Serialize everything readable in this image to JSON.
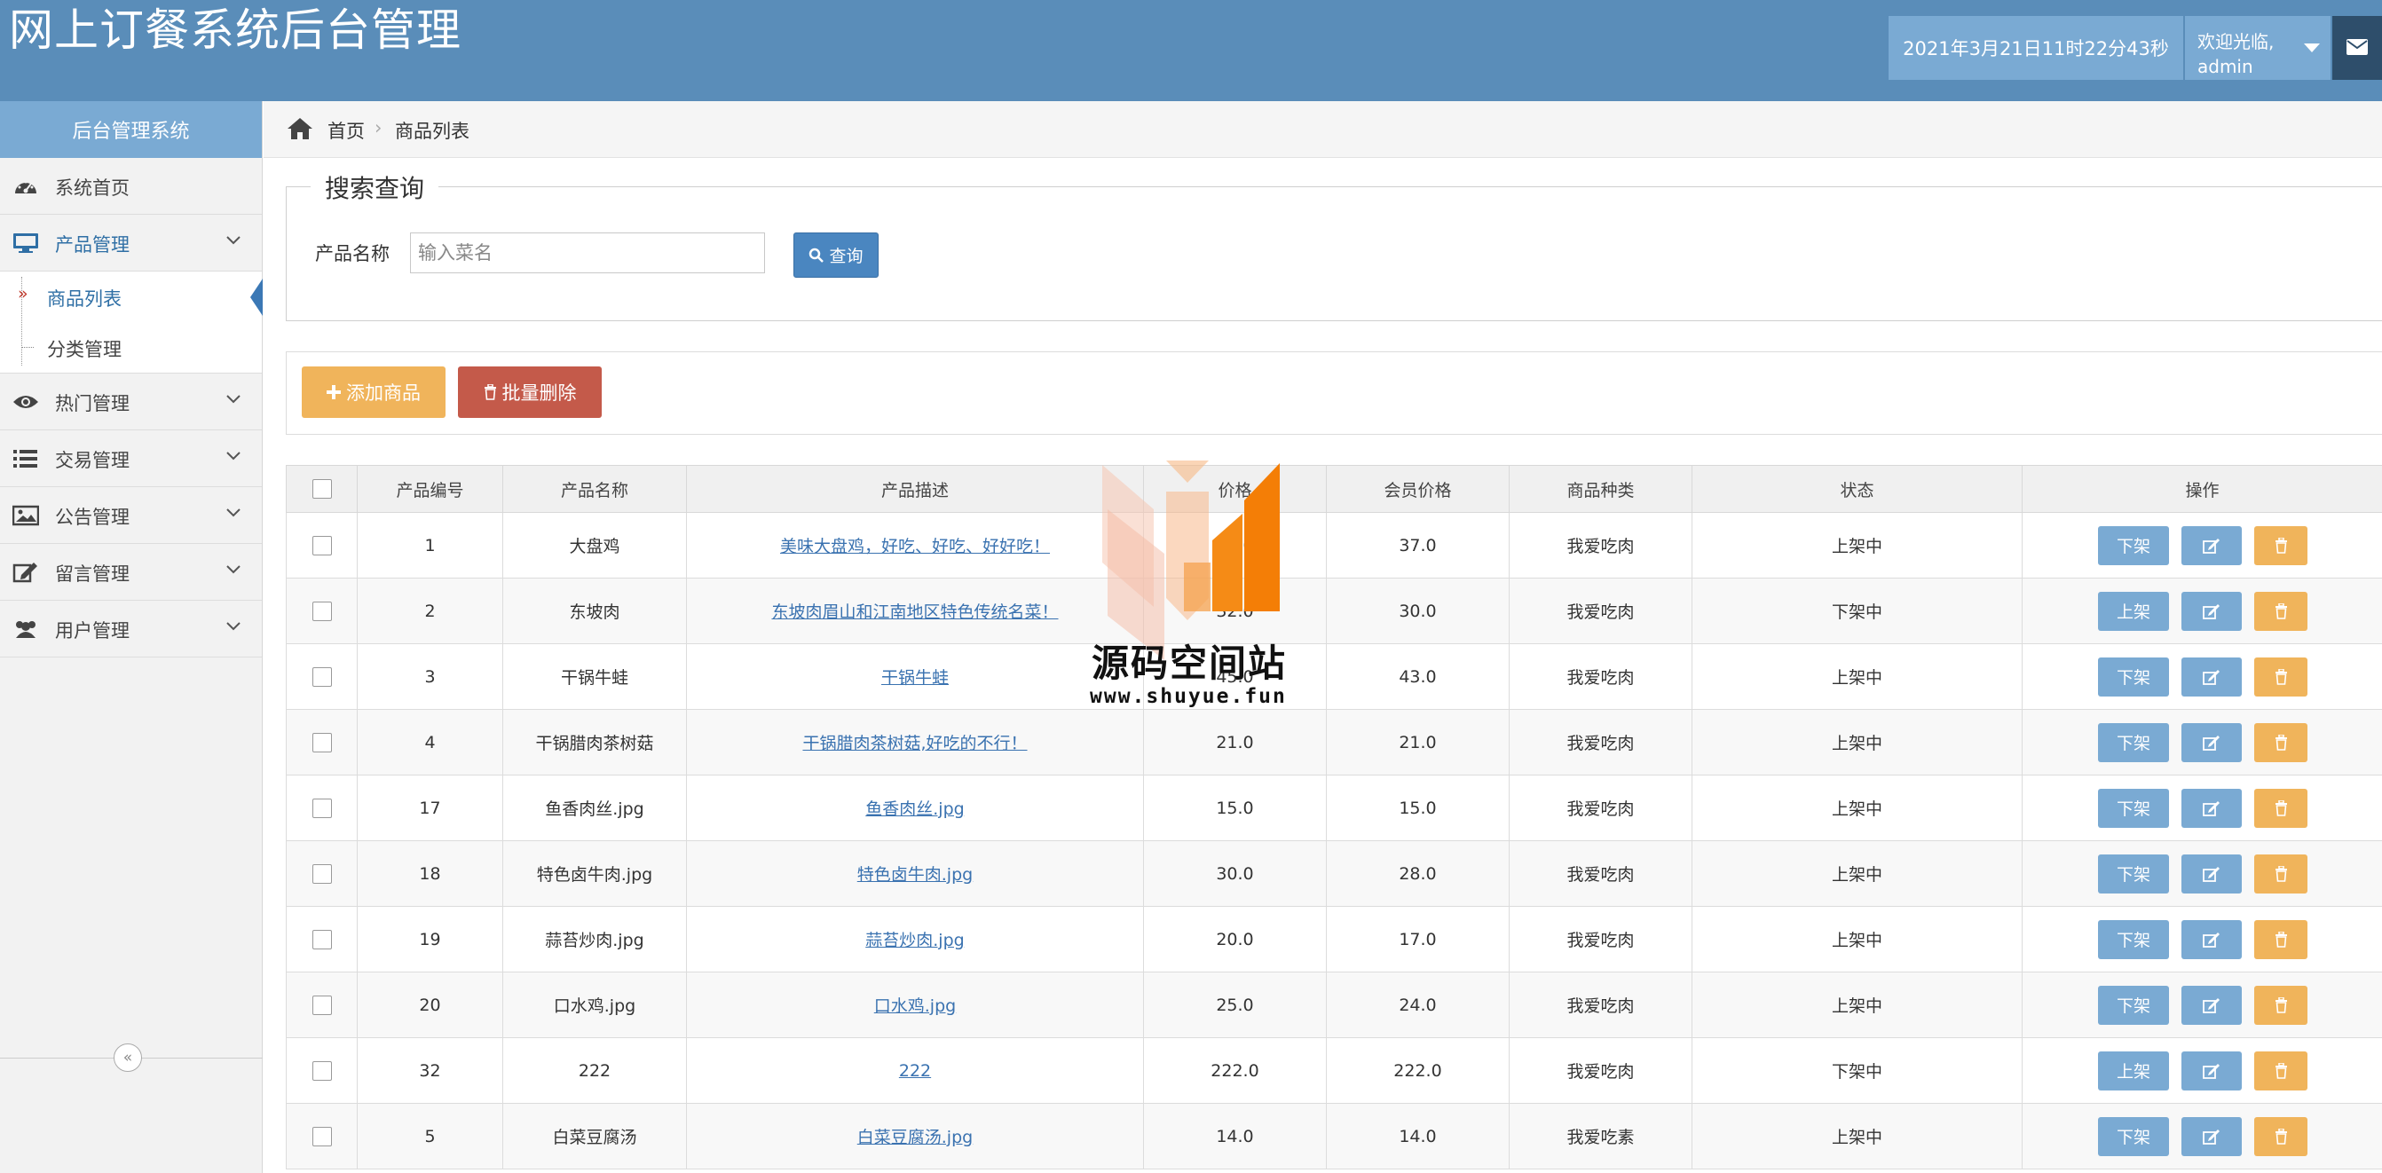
{
  "header": {
    "title": "网上订餐系统后台管理",
    "datetime": "2021年3月21日11时22分43秒",
    "welcome": "欢迎光临,",
    "username": "admin"
  },
  "sidebar": {
    "title": "后台管理系统",
    "items": [
      {
        "label": "系统首页",
        "icon": "dashboard-icon"
      },
      {
        "label": "产品管理",
        "icon": "monitor-icon"
      },
      {
        "label": "热门管理",
        "icon": "eye-icon"
      },
      {
        "label": "交易管理",
        "icon": "list-icon"
      },
      {
        "label": "公告管理",
        "icon": "picture-icon"
      },
      {
        "label": "留言管理",
        "icon": "edit-icon"
      },
      {
        "label": "用户管理",
        "icon": "users-icon"
      }
    ],
    "subitems": [
      {
        "label": "商品列表"
      },
      {
        "label": "分类管理"
      }
    ],
    "collapse_glyph": "«"
  },
  "breadcrumb": {
    "home": "首页",
    "current": "商品列表"
  },
  "search": {
    "legend": "搜索查询",
    "label": "产品名称",
    "placeholder": "输入菜名",
    "button": "查询"
  },
  "actions": {
    "add": "添加商品",
    "batch_delete": "批量删除"
  },
  "table": {
    "columns": [
      "产品编号",
      "产品名称",
      "产品描述",
      "价格",
      "会员价格",
      "商品种类",
      "状态",
      "操作"
    ],
    "rows": [
      {
        "id": "1",
        "name": "大盘鸡",
        "desc": "美味大盘鸡，好吃、好吃、好好吃！",
        "price": "40.0",
        "member_price": "37.0",
        "category": "我爱吃肉",
        "status": "上架中",
        "toggle": "下架"
      },
      {
        "id": "2",
        "name": "东坡肉",
        "desc": "东坡肉眉山和江南地区特色传统名菜！",
        "price": "32.0",
        "member_price": "30.0",
        "category": "我爱吃肉",
        "status": "下架中",
        "toggle": "上架"
      },
      {
        "id": "3",
        "name": "干锅牛蛙",
        "desc": "干锅牛蛙",
        "price": "45.0",
        "member_price": "43.0",
        "category": "我爱吃肉",
        "status": "上架中",
        "toggle": "下架"
      },
      {
        "id": "4",
        "name": "干锅腊肉茶树菇",
        "desc": "干锅腊肉茶树菇,好吃的不行！",
        "price": "21.0",
        "member_price": "21.0",
        "category": "我爱吃肉",
        "status": "上架中",
        "toggle": "下架"
      },
      {
        "id": "17",
        "name": "鱼香肉丝.jpg",
        "desc": "鱼香肉丝.jpg",
        "price": "15.0",
        "member_price": "15.0",
        "category": "我爱吃肉",
        "status": "上架中",
        "toggle": "下架"
      },
      {
        "id": "18",
        "name": "特色卤牛肉.jpg",
        "desc": "特色卤牛肉.jpg",
        "price": "30.0",
        "member_price": "28.0",
        "category": "我爱吃肉",
        "status": "上架中",
        "toggle": "下架"
      },
      {
        "id": "19",
        "name": "蒜苔炒肉.jpg",
        "desc": "蒜苔炒肉.jpg",
        "price": "20.0",
        "member_price": "17.0",
        "category": "我爱吃肉",
        "status": "上架中",
        "toggle": "下架"
      },
      {
        "id": "20",
        "name": "口水鸡.jpg",
        "desc": "口水鸡.jpg",
        "price": "25.0",
        "member_price": "24.0",
        "category": "我爱吃肉",
        "status": "上架中",
        "toggle": "下架"
      },
      {
        "id": "32",
        "name": "222",
        "desc": "222",
        "price": "222.0",
        "member_price": "222.0",
        "category": "我爱吃肉",
        "status": "下架中",
        "toggle": "上架"
      },
      {
        "id": "5",
        "name": "白菜豆腐汤",
        "desc": "白菜豆腐汤.jpg",
        "price": "14.0",
        "member_price": "14.0",
        "category": "我爱吃素",
        "status": "上架中",
        "toggle": "下架"
      }
    ]
  },
  "watermark": {
    "title": "源码空间站",
    "url": "www.shuyue.fun"
  },
  "colors": {
    "header": "#5a8db9",
    "accent": "#7aaad3",
    "primary_button": "#4a86c0",
    "warning_button": "#f0b45b",
    "danger_button": "#c45a4a"
  }
}
